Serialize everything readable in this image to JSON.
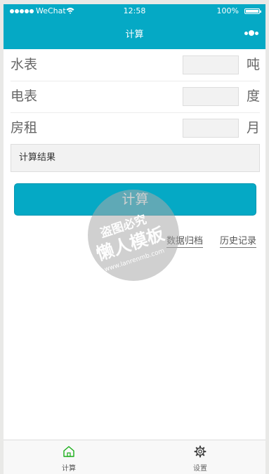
{
  "status_bar": {
    "carrier": "WeChat",
    "time": "12:58",
    "battery": "100%"
  },
  "nav": {
    "title": "计算"
  },
  "form": {
    "rows": [
      {
        "label": "水表",
        "value": "",
        "unit": "吨"
      },
      {
        "label": "电表",
        "value": "",
        "unit": "度"
      },
      {
        "label": "房租",
        "value": "",
        "unit": "月"
      }
    ]
  },
  "result": {
    "label": "计算结果"
  },
  "actions": {
    "calculate": "计算",
    "archive": "数据归档",
    "history": "历史记录"
  },
  "watermark": {
    "top": "盗图必究",
    "main": "懒人模板",
    "url": "www.lanrenmb.com"
  },
  "tabbar": {
    "items": [
      {
        "label": "计算",
        "icon": "home-icon",
        "active": true
      },
      {
        "label": "设置",
        "icon": "gear-icon",
        "active": false
      }
    ]
  },
  "colors": {
    "accent": "#05a9c5",
    "active_tab": "#1aad19"
  }
}
